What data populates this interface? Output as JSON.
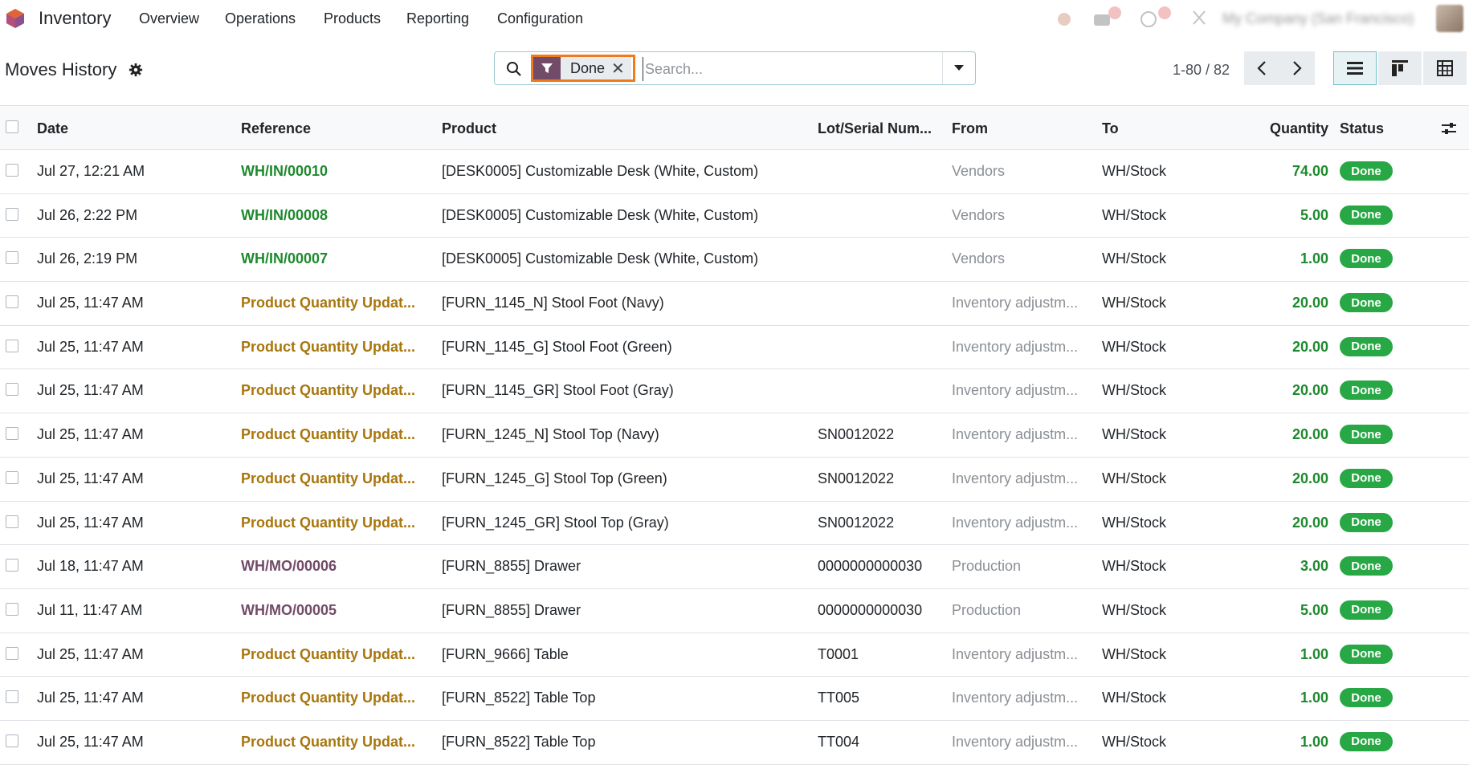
{
  "topbar": {
    "app_name": "Inventory",
    "menu": [
      "Overview",
      "Operations",
      "Products",
      "Reporting",
      "Configuration"
    ],
    "company": "My Company (San Francisco)"
  },
  "control": {
    "title": "Moves History",
    "facet_label": "Done",
    "search_placeholder": "Search...",
    "pager_value": "1-80 / 82"
  },
  "table": {
    "headers": {
      "date": "Date",
      "reference": "Reference",
      "product": "Product",
      "lot": "Lot/Serial Num...",
      "from": "From",
      "to": "To",
      "quantity": "Quantity",
      "status": "Status"
    },
    "rows": [
      {
        "date": "Jul 27, 12:21 AM",
        "reference": "WH/IN/00010",
        "ref_color": "green",
        "product": "[DESK0005] Customizable Desk (White, Custom)",
        "lot": "",
        "from": "Vendors",
        "to": "WH/Stock",
        "quantity": "74.00",
        "status": "Done"
      },
      {
        "date": "Jul 26, 2:22 PM",
        "reference": "WH/IN/00008",
        "ref_color": "green",
        "product": "[DESK0005] Customizable Desk (White, Custom)",
        "lot": "",
        "from": "Vendors",
        "to": "WH/Stock",
        "quantity": "5.00",
        "status": "Done"
      },
      {
        "date": "Jul 26, 2:19 PM",
        "reference": "WH/IN/00007",
        "ref_color": "green",
        "product": "[DESK0005] Customizable Desk (White, Custom)",
        "lot": "",
        "from": "Vendors",
        "to": "WH/Stock",
        "quantity": "1.00",
        "status": "Done"
      },
      {
        "date": "Jul 25, 11:47 AM",
        "reference": "Product Quantity Updat...",
        "ref_color": "amber",
        "product": "[FURN_1145_N] Stool Foot (Navy)",
        "lot": "",
        "from": "Inventory adjustm...",
        "to": "WH/Stock",
        "quantity": "20.00",
        "status": "Done"
      },
      {
        "date": "Jul 25, 11:47 AM",
        "reference": "Product Quantity Updat...",
        "ref_color": "amber",
        "product": "[FURN_1145_G] Stool Foot (Green)",
        "lot": "",
        "from": "Inventory adjustm...",
        "to": "WH/Stock",
        "quantity": "20.00",
        "status": "Done"
      },
      {
        "date": "Jul 25, 11:47 AM",
        "reference": "Product Quantity Updat...",
        "ref_color": "amber",
        "product": "[FURN_1145_GR] Stool Foot (Gray)",
        "lot": "",
        "from": "Inventory adjustm...",
        "to": "WH/Stock",
        "quantity": "20.00",
        "status": "Done"
      },
      {
        "date": "Jul 25, 11:47 AM",
        "reference": "Product Quantity Updat...",
        "ref_color": "amber",
        "product": "[FURN_1245_N] Stool Top (Navy)",
        "lot": "SN0012022",
        "from": "Inventory adjustm...",
        "to": "WH/Stock",
        "quantity": "20.00",
        "status": "Done"
      },
      {
        "date": "Jul 25, 11:47 AM",
        "reference": "Product Quantity Updat...",
        "ref_color": "amber",
        "product": "[FURN_1245_G] Stool Top (Green)",
        "lot": "SN0012022",
        "from": "Inventory adjustm...",
        "to": "WH/Stock",
        "quantity": "20.00",
        "status": "Done"
      },
      {
        "date": "Jul 25, 11:47 AM",
        "reference": "Product Quantity Updat...",
        "ref_color": "amber",
        "product": "[FURN_1245_GR] Stool Top (Gray)",
        "lot": "SN0012022",
        "from": "Inventory adjustm...",
        "to": "WH/Stock",
        "quantity": "20.00",
        "status": "Done"
      },
      {
        "date": "Jul 18, 11:47 AM",
        "reference": "WH/MO/00006",
        "ref_color": "purple",
        "product": "[FURN_8855] Drawer",
        "lot": "0000000000030",
        "from": "Production",
        "to": "WH/Stock",
        "quantity": "3.00",
        "status": "Done"
      },
      {
        "date": "Jul 11, 11:47 AM",
        "reference": "WH/MO/00005",
        "ref_color": "purple",
        "product": "[FURN_8855] Drawer",
        "lot": "0000000000030",
        "from": "Production",
        "to": "WH/Stock",
        "quantity": "5.00",
        "status": "Done"
      },
      {
        "date": "Jul 25, 11:47 AM",
        "reference": "Product Quantity Updat...",
        "ref_color": "amber",
        "product": "[FURN_9666] Table",
        "lot": "T0001",
        "from": "Inventory adjustm...",
        "to": "WH/Stock",
        "quantity": "1.00",
        "status": "Done"
      },
      {
        "date": "Jul 25, 11:47 AM",
        "reference": "Product Quantity Updat...",
        "ref_color": "amber",
        "product": "[FURN_8522] Table Top",
        "lot": "TT005",
        "from": "Inventory adjustm...",
        "to": "WH/Stock",
        "quantity": "1.00",
        "status": "Done"
      },
      {
        "date": "Jul 25, 11:47 AM",
        "reference": "Product Quantity Updat...",
        "ref_color": "amber",
        "product": "[FURN_8522] Table Top",
        "lot": "TT004",
        "from": "Inventory adjustm...",
        "to": "WH/Stock",
        "quantity": "1.00",
        "status": "Done"
      }
    ]
  },
  "colors": {
    "brand": "#714b67",
    "highlight": "#f07b1d",
    "ref_green": "#1e8a2e",
    "ref_amber": "#a8760c",
    "badge_green": "#28a745"
  }
}
